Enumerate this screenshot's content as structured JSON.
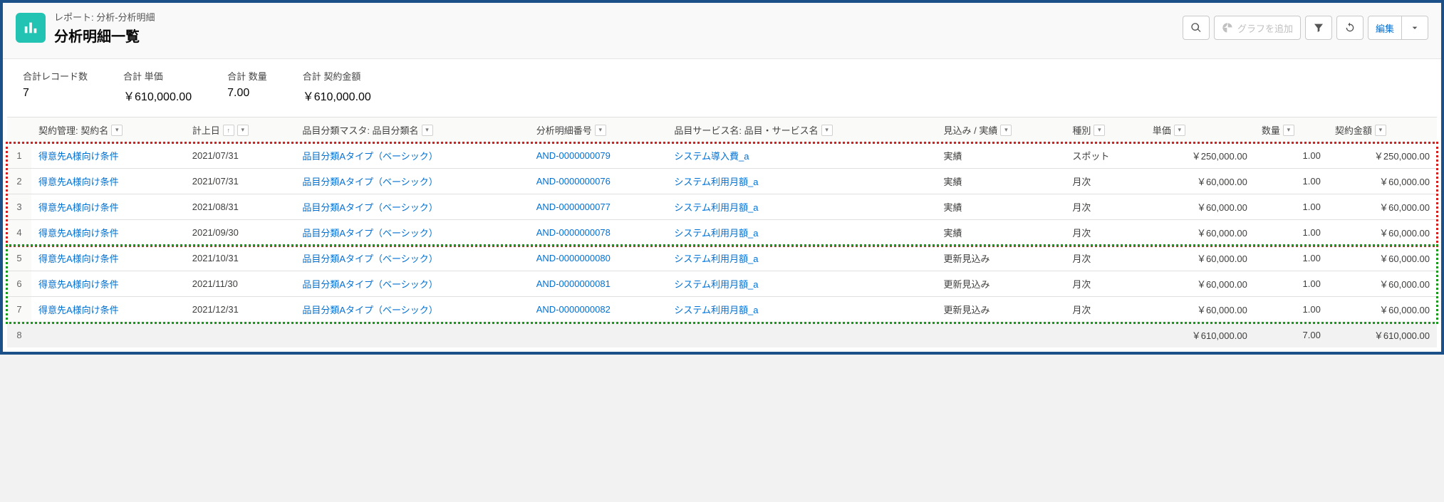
{
  "header": {
    "breadcrumb": "レポート: 分析-分析明細",
    "title": "分析明細一覧",
    "add_chart_label": "グラフを追加",
    "edit_label": "編集"
  },
  "summary": {
    "metrics": [
      {
        "label": "合計レコード数",
        "value": "7"
      },
      {
        "label": "合計 単価",
        "value": "￥610,000.00"
      },
      {
        "label": "合計 数量",
        "value": "7.00"
      },
      {
        "label": "合計 契約金額",
        "value": "￥610,000.00"
      }
    ]
  },
  "columns": [
    {
      "label": "契約管理: 契約名",
      "filter": true
    },
    {
      "label": "計上日",
      "filter": true,
      "sort_asc": true
    },
    {
      "label": "品目分類マスタ: 品目分類名",
      "filter": true
    },
    {
      "label": "分析明細番号",
      "filter": true
    },
    {
      "label": "品目サービス名: 品目・サービス名",
      "filter": true
    },
    {
      "label": "見込み / 実績",
      "filter": true
    },
    {
      "label": "種別",
      "filter": true
    },
    {
      "label": "単価",
      "filter": true,
      "align": "right"
    },
    {
      "label": "数量",
      "filter": true,
      "align": "right"
    },
    {
      "label": "契約金額",
      "filter": true,
      "align": "right"
    }
  ],
  "rows": [
    {
      "n": "1",
      "contract": "得意先A様向け条件",
      "date": "2021/07/31",
      "cat": "品目分類Aタイプ（ベーシック）",
      "id": "AND-0000000079",
      "service": "システム導入費_a",
      "status": "実績",
      "type": "スポット",
      "unit": "￥250,000.00",
      "qty": "1.00",
      "amount": "￥250,000.00"
    },
    {
      "n": "2",
      "contract": "得意先A様向け条件",
      "date": "2021/07/31",
      "cat": "品目分類Aタイプ（ベーシック）",
      "id": "AND-0000000076",
      "service": "システム利用月額_a",
      "status": "実績",
      "type": "月次",
      "unit": "￥60,000.00",
      "qty": "1.00",
      "amount": "￥60,000.00"
    },
    {
      "n": "3",
      "contract": "得意先A様向け条件",
      "date": "2021/08/31",
      "cat": "品目分類Aタイプ（ベーシック）",
      "id": "AND-0000000077",
      "service": "システム利用月額_a",
      "status": "実績",
      "type": "月次",
      "unit": "￥60,000.00",
      "qty": "1.00",
      "amount": "￥60,000.00"
    },
    {
      "n": "4",
      "contract": "得意先A様向け条件",
      "date": "2021/09/30",
      "cat": "品目分類Aタイプ（ベーシック）",
      "id": "AND-0000000078",
      "service": "システム利用月額_a",
      "status": "実績",
      "type": "月次",
      "unit": "￥60,000.00",
      "qty": "1.00",
      "amount": "￥60,000.00"
    },
    {
      "n": "5",
      "contract": "得意先A様向け条件",
      "date": "2021/10/31",
      "cat": "品目分類Aタイプ（ベーシック）",
      "id": "AND-0000000080",
      "service": "システム利用月額_a",
      "status": "更新見込み",
      "type": "月次",
      "unit": "￥60,000.00",
      "qty": "1.00",
      "amount": "￥60,000.00"
    },
    {
      "n": "6",
      "contract": "得意先A様向け条件",
      "date": "2021/11/30",
      "cat": "品目分類Aタイプ（ベーシック）",
      "id": "AND-0000000081",
      "service": "システム利用月額_a",
      "status": "更新見込み",
      "type": "月次",
      "unit": "￥60,000.00",
      "qty": "1.00",
      "amount": "￥60,000.00"
    },
    {
      "n": "7",
      "contract": "得意先A様向け条件",
      "date": "2021/12/31",
      "cat": "品目分類Aタイプ（ベーシック）",
      "id": "AND-0000000082",
      "service": "システム利用月額_a",
      "status": "更新見込み",
      "type": "月次",
      "unit": "￥60,000.00",
      "qty": "1.00",
      "amount": "￥60,000.00"
    }
  ],
  "totals": {
    "n": "8",
    "unit": "￥610,000.00",
    "qty": "7.00",
    "amount": "￥610,000.00"
  }
}
